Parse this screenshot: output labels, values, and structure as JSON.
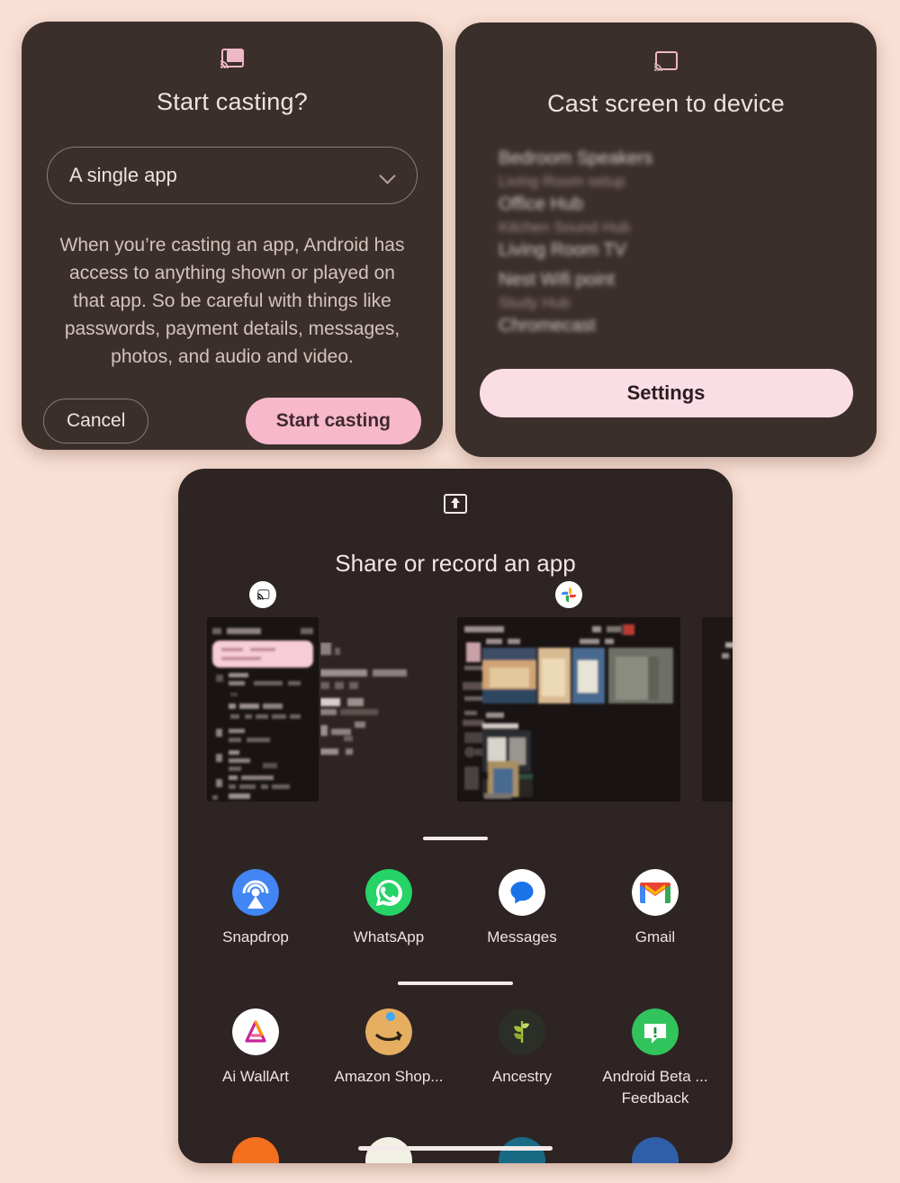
{
  "meta": {
    "background_color": "#f9e0d4",
    "surface_color": "#3b2f2c",
    "sheet_color": "#2e2423",
    "accent_pink": "#f7b8cb",
    "accent_pink_light": "#fadde5",
    "text_primary": "#efe3df",
    "text_secondary": "#d3c3bd"
  },
  "cast_app_dialog": {
    "icon": "cast-icon",
    "title": "Start casting?",
    "select": {
      "value": "A single app",
      "chevron": "chevron-down-icon"
    },
    "body": "When you’re casting an app, Android has access to anything shown or played on that app. So be careful with things like passwords, payment details, messages, photos, and audio and video.",
    "cancel_label": "Cancel",
    "confirm_label": "Start casting"
  },
  "cast_device_dialog": {
    "icon": "cast-icon",
    "title": "Cast screen to device",
    "devices": [
      {
        "name": "Bedroom Speakers",
        "type": "primary"
      },
      {
        "name": "Living Room setup",
        "type": "secondary"
      },
      {
        "name": "Office Hub",
        "type": "primary"
      },
      {
        "name": "Kitchen Sound Hub",
        "type": "secondary"
      },
      {
        "name": "Living Room TV",
        "type": "primary"
      },
      {
        "name": "Nest Wifi point",
        "type": "primary"
      },
      {
        "name": "Study Hub",
        "type": "secondary"
      },
      {
        "name": "Chromecast",
        "type": "primary"
      }
    ],
    "settings_label": "Settings"
  },
  "share_sheet": {
    "icon": "screen-share-icon",
    "title": "Share or record an app",
    "thumbnails": [
      {
        "badge": "cast-icon",
        "app": "app-preview-1"
      },
      {
        "badge": "photos-icon",
        "app": "app-preview-2"
      },
      {
        "badge": "",
        "app": "app-preview-3"
      }
    ],
    "apps_row_1": [
      {
        "label": "Snapdrop",
        "icon": "snapdrop-icon"
      },
      {
        "label": "WhatsApp",
        "icon": "whatsapp-icon"
      },
      {
        "label": "Messages",
        "icon": "messages-icon"
      },
      {
        "label": "Gmail",
        "icon": "gmail-icon"
      }
    ],
    "apps_row_2": [
      {
        "label": "Ai WallArt",
        "icon": "ai-wallart-icon"
      },
      {
        "label": "Amazon Shop...",
        "icon": "amazon-icon"
      },
      {
        "label": "Ancestry",
        "icon": "ancestry-icon"
      },
      {
        "label": "Android Beta ...",
        "label2": "Feedback",
        "icon": "android-beta-icon"
      }
    ],
    "apps_row_3_colors": [
      "#f4701e",
      "#f2efe4",
      "#186a85",
      "#2e5fa8"
    ]
  }
}
